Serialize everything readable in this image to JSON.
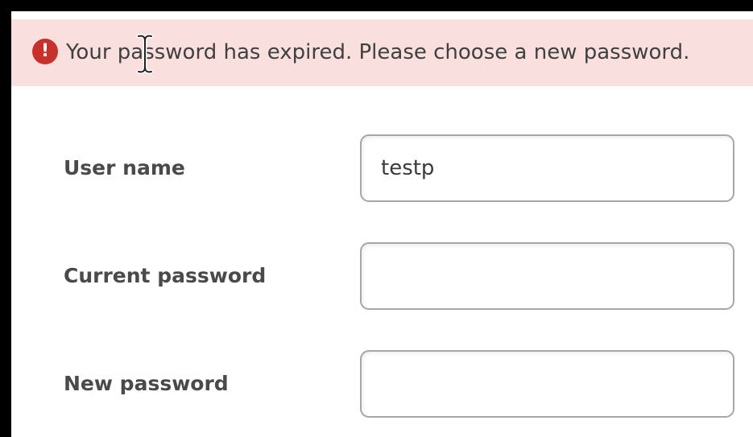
{
  "alert": {
    "icon": "exclamation-circle-icon",
    "icon_glyph": "!",
    "message": "Your password has expired. Please choose a new password.",
    "color": "#f9e0de",
    "icon_color": "#c9302c"
  },
  "form": {
    "username": {
      "label": "User name",
      "value": "testp"
    },
    "current_password": {
      "label": "Current password",
      "value": ""
    },
    "new_password": {
      "label": "New password",
      "value": ""
    }
  }
}
